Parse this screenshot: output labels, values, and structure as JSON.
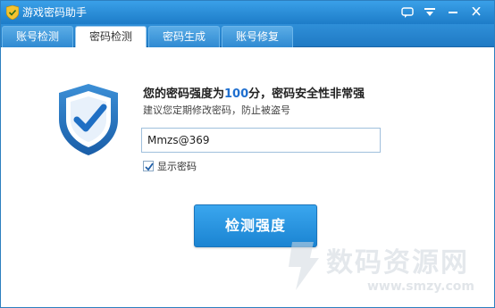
{
  "window": {
    "title": "游戏密码助手",
    "icon": "shield-icon"
  },
  "tabs": [
    {
      "label": "账号检测",
      "active": false
    },
    {
      "label": "密码检测",
      "active": true
    },
    {
      "label": "密码生成",
      "active": false
    },
    {
      "label": "账号修复",
      "active": false
    }
  ],
  "result": {
    "heading_prefix": "您的密码强度为",
    "score": "100",
    "heading_suffix": "分，密码安全性非常强",
    "advice": "建议您定期修改密码，防止被盗号"
  },
  "password_field": {
    "value": "Mmzs@369"
  },
  "show_password": {
    "label": "显示密码",
    "checked": true
  },
  "check_button": {
    "label": "检测强度"
  },
  "watermark": {
    "text": "数码资源网",
    "url": "www.smzy.com"
  },
  "colors": {
    "titlebar": "#1d7cc8",
    "accent": "#1f6fcf",
    "button": "#2590dc"
  }
}
